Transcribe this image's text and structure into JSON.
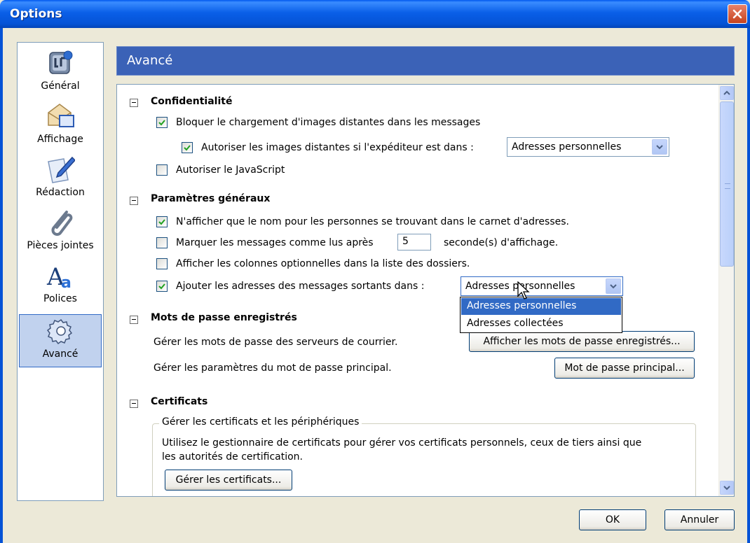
{
  "window": {
    "title": "Options"
  },
  "sidebar": {
    "items": [
      {
        "label": "Général",
        "icon": "general-icon"
      },
      {
        "label": "Affichage",
        "icon": "display-icon"
      },
      {
        "label": "Rédaction",
        "icon": "composition-icon"
      },
      {
        "label": "Pièces jointes",
        "icon": "paperclip-icon"
      },
      {
        "label": "Polices",
        "icon": "fonts-icon"
      },
      {
        "label": "Avancé",
        "icon": "gear-icon",
        "selected": true
      }
    ]
  },
  "panel": {
    "title": "Avancé"
  },
  "privacy": {
    "heading": "Confidentialité",
    "block_images": {
      "label": "Bloquer le chargement d'images distantes dans les messages",
      "checked": true
    },
    "allow_images_sender": {
      "label": "Autoriser les images distantes si l'expéditeur est dans :",
      "checked": true,
      "select_value": "Adresses personnelles"
    },
    "allow_js": {
      "label": "Autoriser le JavaScript",
      "checked": false
    }
  },
  "general": {
    "heading": "Paramètres généraux",
    "show_name_only": {
      "label": "N'afficher que le nom pour les personnes se trouvant dans le carnet d'adresses.",
      "checked": true
    },
    "mark_read": {
      "label": "Marquer les messages comme lus après",
      "checked": false,
      "value": "5",
      "suffix": "seconde(s) d'affichage."
    },
    "optional_columns": {
      "label": "Afficher les colonnes optionnelles dans la liste des dossiers.",
      "checked": false
    },
    "add_outgoing": {
      "label": "Ajouter les adresses des messages sortants dans :",
      "checked": true,
      "select_value": "Adresses personnelles",
      "options": [
        "Adresses personnelles",
        "Adresses collectées"
      ]
    }
  },
  "passwords": {
    "heading": "Mots de passe enregistrés",
    "servers_label": "Gérer les mots de passe des serveurs de courrier.",
    "servers_button": "Afficher les mots de passe enregistrés...",
    "master_label": "Gérer les paramètres du mot de passe principal.",
    "master_button": "Mot de passe principal..."
  },
  "certificates": {
    "heading": "Certificats",
    "group_title": "Gérer les certificats et les périphériques",
    "description_line1": "Utilisez le gestionnaire de certificats pour gérer vos certificats personnels, ceux de tiers ainsi que",
    "description_line2": "les autorités de certification.",
    "manage_button": "Gérer les certificats..."
  },
  "footer": {
    "ok": "OK",
    "cancel": "Annuler"
  },
  "colors": {
    "titlebar": "#0553D6",
    "header": "#3B62B7",
    "selection": "#316AC5",
    "close": "#C6431E"
  }
}
